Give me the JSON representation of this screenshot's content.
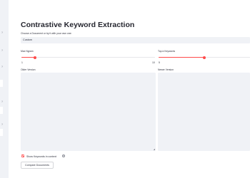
{
  "title": "Contrastive Keyword Extraction",
  "document_select": {
    "label": "Choose a Document or try it with your own one:",
    "value": "Custom"
  },
  "max_ngram": {
    "label": "Max Ngram",
    "value": "1",
    "max": "10",
    "fraction": 0.1
  },
  "top_k": {
    "label": "Top-k Keywords",
    "value": "5",
    "max": "10",
    "fraction": 0.5
  },
  "older_version": {
    "label": "Older Version",
    "value": ""
  },
  "newer_version": {
    "label": "Newer Version",
    "value": ""
  },
  "show_keywords": {
    "label": "Show Keywords in context",
    "checked": true
  },
  "compare_button": {
    "label": "Compare Documents"
  },
  "colors": {
    "accent": "#ff4b4b",
    "input_bg": "#f0f2f6",
    "sidebar_bg": "#f0f2f6"
  }
}
